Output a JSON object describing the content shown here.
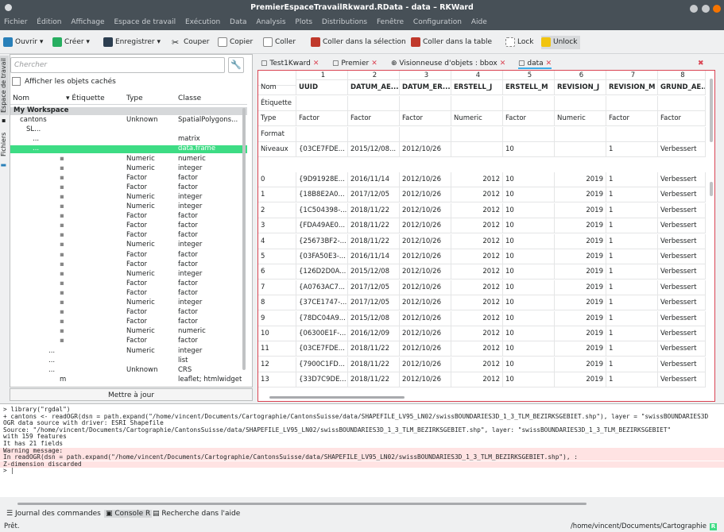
{
  "window": {
    "title": "PremierEspaceTravailRkward.RData - data – RKWard"
  },
  "menu": [
    "Fichier",
    "Édition",
    "Affichage",
    "Espace de travail",
    "Exécution",
    "Data",
    "Analysis",
    "Plots",
    "Distributions",
    "Fenêtre",
    "Configuration",
    "Aide"
  ],
  "toolbar": {
    "open": "Ouvrir",
    "create": "Créer",
    "save": "Enregistrer",
    "cut": "Couper",
    "copy": "Copier",
    "paste": "Coller",
    "paste_sel": "Coller dans la sélection",
    "paste_table": "Coller dans la table",
    "lock": "Lock",
    "unlock": "Unlock"
  },
  "sidetabs": {
    "workspace": "Espace de travail",
    "files": "Fichiers",
    "debugger": "Trames du débogueur"
  },
  "workspace": {
    "search_placeholder": "Chercher",
    "show_hidden": "Afficher les objets cachés",
    "headers": {
      "name": "Nom",
      "label": "Étiquette",
      "type": "Type",
      "class": "Classe"
    },
    "rows": [
      {
        "name": "My Workspace",
        "type": "",
        "class": ""
      },
      {
        "name": "cantons",
        "type": "Unknown",
        "class": "SpatialPolygons..."
      },
      {
        "name": "SL...",
        "type": "",
        "class": ""
      },
      {
        "name": "...",
        "type": "",
        "class": "matrix"
      },
      {
        "name": "...",
        "type": "",
        "class": "data.frame"
      },
      {
        "name": "",
        "type": "Numeric",
        "class": "numeric"
      },
      {
        "name": "",
        "type": "Numeric",
        "class": "integer"
      },
      {
        "name": "",
        "type": "Factor",
        "class": "factor"
      },
      {
        "name": "",
        "type": "Factor",
        "class": "factor"
      },
      {
        "name": "",
        "type": "Numeric",
        "class": "integer"
      },
      {
        "name": "",
        "type": "Numeric",
        "class": "integer"
      },
      {
        "name": "",
        "type": "Factor",
        "class": "factor"
      },
      {
        "name": "",
        "type": "Factor",
        "class": "factor"
      },
      {
        "name": "",
        "type": "Factor",
        "class": "factor"
      },
      {
        "name": "",
        "type": "Numeric",
        "class": "integer"
      },
      {
        "name": "",
        "type": "Factor",
        "class": "factor"
      },
      {
        "name": "",
        "type": "Factor",
        "class": "factor"
      },
      {
        "name": "",
        "type": "Numeric",
        "class": "integer"
      },
      {
        "name": "",
        "type": "Factor",
        "class": "factor"
      },
      {
        "name": "",
        "type": "Factor",
        "class": "factor"
      },
      {
        "name": "",
        "type": "Numeric",
        "class": "integer"
      },
      {
        "name": "",
        "type": "Factor",
        "class": "factor"
      },
      {
        "name": "",
        "type": "Factor",
        "class": "factor"
      },
      {
        "name": "",
        "type": "Numeric",
        "class": "numeric"
      },
      {
        "name": "",
        "type": "Factor",
        "class": "factor"
      },
      {
        "name": "...",
        "type": "Numeric",
        "class": "integer"
      },
      {
        "name": "...",
        "type": "",
        "class": "list"
      },
      {
        "name": "...",
        "type": "Unknown",
        "class": "CRS"
      },
      {
        "name": "m",
        "type": "",
        "class": "leaflet; htmlwidget"
      }
    ],
    "update_button": "Mettre à jour"
  },
  "tabs": [
    {
      "label": "Test1Kward"
    },
    {
      "label": "Premier"
    },
    {
      "label": "Visionneuse d'objets : bbox"
    },
    {
      "label": "data"
    }
  ],
  "grid": {
    "col_numbers": [
      "1",
      "2",
      "3",
      "4",
      "5",
      "6",
      "7",
      "8"
    ],
    "meta_labels": [
      "Nom",
      "Étiquette",
      "Type",
      "Format",
      "Niveaux"
    ],
    "meta": [
      {
        "name": "UUID",
        "type": "Factor",
        "levels": "{03CE7FDE..."
      },
      {
        "name": "DATUM_AE...",
        "type": "Factor",
        "levels": "2015/12/08..."
      },
      {
        "name": "DATUM_ER...",
        "type": "Factor",
        "levels": "2012/10/26"
      },
      {
        "name": "ERSTELL_J",
        "type": "Numeric",
        "levels": ""
      },
      {
        "name": "ERSTELL_M",
        "type": "Factor",
        "levels": "10"
      },
      {
        "name": "REVISION_J",
        "type": "Numeric",
        "levels": ""
      },
      {
        "name": "REVISION_M",
        "type": "Factor",
        "levels": "1"
      },
      {
        "name": "GRUND_AE...",
        "type": "Factor",
        "levels": "Verbessert"
      }
    ],
    "rows": [
      {
        "i": "0",
        "c": [
          "{9D91928E...",
          "2016/11/14",
          "2012/10/26",
          "2012",
          "10",
          "2019",
          "1",
          "Verbessert"
        ]
      },
      {
        "i": "1",
        "c": [
          "{18B8E2A0...",
          "2017/12/05",
          "2012/10/26",
          "2012",
          "10",
          "2019",
          "1",
          "Verbessert"
        ]
      },
      {
        "i": "2",
        "c": [
          "{1C504398-...",
          "2018/11/22",
          "2012/10/26",
          "2012",
          "10",
          "2019",
          "1",
          "Verbessert"
        ]
      },
      {
        "i": "3",
        "c": [
          "{FDA49AE0...",
          "2018/11/22",
          "2012/10/26",
          "2012",
          "10",
          "2019",
          "1",
          "Verbessert"
        ]
      },
      {
        "i": "4",
        "c": [
          "{25673BF2-...",
          "2018/11/22",
          "2012/10/26",
          "2012",
          "10",
          "2019",
          "1",
          "Verbessert"
        ]
      },
      {
        "i": "5",
        "c": [
          "{03FA50E3-...",
          "2016/11/14",
          "2012/10/26",
          "2012",
          "10",
          "2019",
          "1",
          "Verbessert"
        ]
      },
      {
        "i": "6",
        "c": [
          "{126D2D0A...",
          "2015/12/08",
          "2012/10/26",
          "2012",
          "10",
          "2019",
          "1",
          "Verbessert"
        ]
      },
      {
        "i": "7",
        "c": [
          "{A0763AC7...",
          "2017/12/05",
          "2012/10/26",
          "2012",
          "10",
          "2019",
          "1",
          "Verbessert"
        ]
      },
      {
        "i": "8",
        "c": [
          "{37CE1747-...",
          "2017/12/05",
          "2012/10/26",
          "2012",
          "10",
          "2019",
          "1",
          "Verbessert"
        ]
      },
      {
        "i": "9",
        "c": [
          "{78DC04A9...",
          "2015/12/08",
          "2012/10/26",
          "2012",
          "10",
          "2019",
          "1",
          "Verbessert"
        ]
      },
      {
        "i": "10",
        "c": [
          "{06300E1F-...",
          "2016/12/09",
          "2012/10/26",
          "2012",
          "10",
          "2019",
          "1",
          "Verbessert"
        ]
      },
      {
        "i": "11",
        "c": [
          "{03CE7FDE...",
          "2018/11/22",
          "2012/10/26",
          "2012",
          "10",
          "2019",
          "1",
          "Verbessert"
        ]
      },
      {
        "i": "12",
        "c": [
          "{7900C1FD...",
          "2018/11/22",
          "2012/10/26",
          "2012",
          "10",
          "2019",
          "1",
          "Verbessert"
        ]
      },
      {
        "i": "13",
        "c": [
          "{33D7C9DE...",
          "2018/11/22",
          "2012/10/26",
          "2012",
          "10",
          "2019",
          "1",
          "Verbessert"
        ]
      }
    ]
  },
  "console": {
    "lines": [
      {
        "t": "> library(\"rgdal\")",
        "w": false
      },
      {
        "t": "+ cantons <- readOGR(dsn = path.expand(\"/home/vincent/Documents/Cartographie/CantonsSuisse/data/SHAPEFILE_LV95_LN02/swissBOUNDARIES3D_1_3_TLM_BEZIRKSGEBIET.shp\"), layer = \"swissBOUNDARIES3D",
        "w": false
      },
      {
        "t": "OGR data source with driver: ESRI Shapefile",
        "w": false
      },
      {
        "t": "Source: \"/home/vincent/Documents/Cartographie/CantonsSuisse/data/SHAPEFILE_LV95_LN02/swissBOUNDARIES3D_1_3_TLM_BEZIRKSGEBIET.shp\", layer: \"swissBOUNDARIES3D_1_3_TLM_BEZIRKSGEBIET\"",
        "w": false
      },
      {
        "t": "with 159 features",
        "w": false
      },
      {
        "t": "It has 21 fields",
        "w": false
      },
      {
        "t": "Warning message:",
        "w": true
      },
      {
        "t": "In readOGR(dsn = path.expand(\"/home/vincent/Documents/Cartographie/CantonsSuisse/data/SHAPEFILE_LV95_LN02/swissBOUNDARIES3D_1_3_TLM_BEZIRKSGEBIET.shp\"),  :",
        "w": true
      },
      {
        "t": "  Z-dimension discarded",
        "w": true
      },
      {
        "t": "> |",
        "w": false
      }
    ]
  },
  "bottom_tabs": {
    "history": "Journal des commandes",
    "console": "Console R",
    "help": "Recherche dans l'aide"
  },
  "status": {
    "left": "Prêt.",
    "right": "/home/vincent/Documents/Cartographie"
  },
  "colors": {
    "accent": "#3ddc84",
    "error_border": "#da4453",
    "titlebar": "#475057"
  }
}
